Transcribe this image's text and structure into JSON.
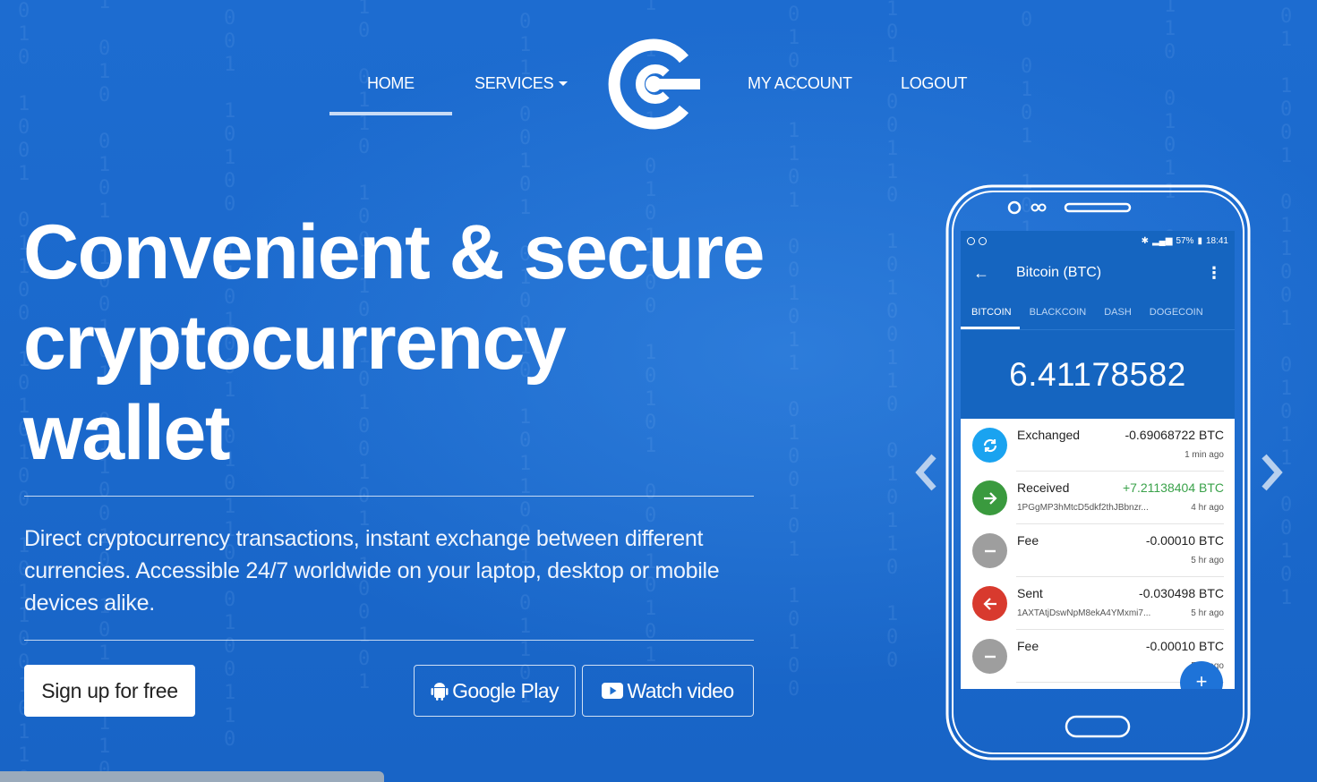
{
  "nav": {
    "home": "HOME",
    "services": "SERVICES",
    "my_account": "MY ACCOUNT",
    "logout": "LOGOUT"
  },
  "hero": {
    "title_line1": "Convenient & secure",
    "title_line2": "cryptocurrency",
    "title_line3": "wallet",
    "description": "Direct cryptocurrency transactions, instant exchange between different currencies. Accessible 24/7 worldwide on your laptop, desktop or mobile devices alike.",
    "signup_label": "Sign up for free",
    "google_play_label": "Google Play",
    "watch_video_label": "Watch video"
  },
  "phone": {
    "status": {
      "battery": "57%",
      "time": "18:41"
    },
    "app_title": "Bitcoin (BTC)",
    "tabs": [
      "BITCOIN",
      "BLACKCOIN",
      "DASH",
      "DOGECOIN"
    ],
    "balance": "6.41178582",
    "transactions": [
      {
        "label": "Exchanged",
        "amount": "-0.69068722 BTC",
        "sub": "",
        "time": "1 min ago",
        "type": "exchange"
      },
      {
        "label": "Received",
        "amount": "+7.21138404 BTC",
        "sub": "1PGgMP3hMtcD5dkf2thJBbnzr...",
        "time": "4 hr ago",
        "type": "received"
      },
      {
        "label": "Fee",
        "amount": "-0.00010 BTC",
        "sub": "",
        "time": "5 hr ago",
        "type": "fee"
      },
      {
        "label": "Sent",
        "amount": "-0.030498 BTC",
        "sub": "1AXTAtjDswNpM8ekA4YMxmi7...",
        "time": "5 hr ago",
        "type": "sent"
      },
      {
        "label": "Fee",
        "amount": "-0.00010 BTC",
        "sub": "",
        "time": "5 hr ago",
        "type": "fee"
      }
    ],
    "fab_label": "+"
  },
  "colors": {
    "background": "#1e6fd0",
    "app_blue": "#1565c0",
    "exchange": "#1aa3f0",
    "received": "#3a9a3e",
    "fee": "#9e9e9e",
    "sent": "#d83a2e",
    "positive_amount": "#3aa24a"
  },
  "icons": {
    "logo": "coin-logo-icon",
    "google_play": "android-icon",
    "watch_video": "youtube-icon",
    "carousel_prev": "chevron-left-icon",
    "carousel_next": "chevron-right-icon"
  }
}
